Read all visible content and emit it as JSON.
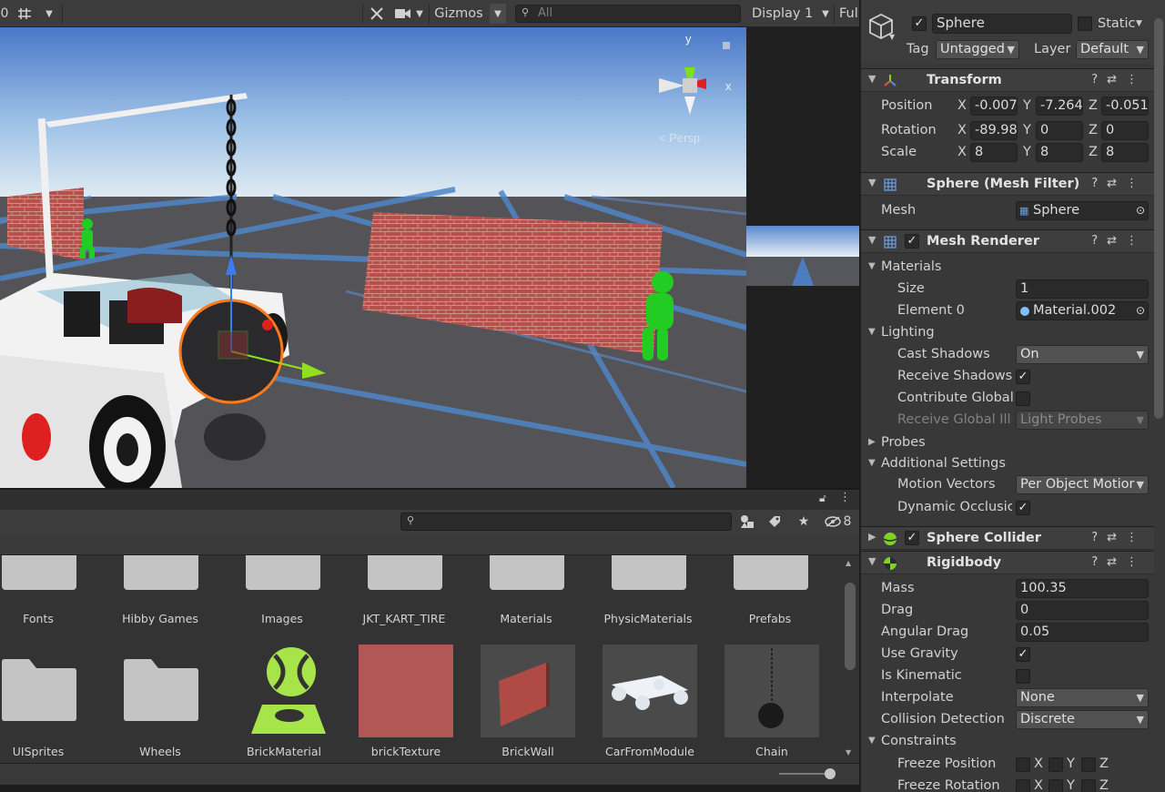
{
  "scene_toolbar": {
    "left_number": "0",
    "grid_icon": "grid-snap-icon",
    "gizmos_label": "Gizmos",
    "search_placeholder": "All"
  },
  "game_toolbar": {
    "display_label": "Display 1",
    "size_label": "Ful"
  },
  "scene": {
    "persp_label": "< Persp",
    "axis_y": "y",
    "axis_x": "x"
  },
  "project": {
    "lock_icon": "lock-icon",
    "hidden_count": "8",
    "folders_row1": [
      "Fonts",
      "Hibby Games",
      "Images",
      "JKT_KART_TIRE",
      "Materials",
      "PhysicMaterials",
      "Prefabs"
    ],
    "assets_row2": [
      "UISprites",
      "Wheels",
      "BrickMaterial",
      "brickTexture",
      "BrickWall",
      "CarFromModule",
      "Chain"
    ]
  },
  "inspector": {
    "object_name": "Sphere",
    "object_active": true,
    "static_label": "Static",
    "tag_label": "Tag",
    "tag_value": "Untagged",
    "layer_label": "Layer",
    "layer_value": "Default",
    "transform": {
      "title": "Transform",
      "position_label": "Position",
      "rotation_label": "Rotation",
      "scale_label": "Scale",
      "position": {
        "x": "-0.007",
        "y": "-7.264",
        "z": "-0.051"
      },
      "rotation": {
        "x": "-89.98",
        "y": "0",
        "z": "0"
      },
      "scale": {
        "x": "8",
        "y": "8",
        "z": "8"
      }
    },
    "mesh_filter": {
      "title": "Sphere (Mesh Filter)",
      "mesh_label": "Mesh",
      "mesh_value": "Sphere"
    },
    "mesh_renderer": {
      "title": "Mesh Renderer",
      "materials_label": "Materials",
      "size_label": "Size",
      "size_value": "1",
      "element0_label": "Element 0",
      "element0_value": "Material.002",
      "lighting_label": "Lighting",
      "cast_shadows_label": "Cast Shadows",
      "cast_shadows_value": "On",
      "receive_shadows_label": "Receive Shadows",
      "contribute_gi_label": "Contribute Global",
      "receive_gi_label": "Receive Global Illu",
      "receive_gi_value": "Light Probes",
      "probes_label": "Probes",
      "additional_label": "Additional Settings",
      "motion_vectors_label": "Motion Vectors",
      "motion_vectors_value": "Per Object Motior",
      "dynamic_occlusion_label": "Dynamic Occlusic"
    },
    "sphere_collider": {
      "title": "Sphere Collider"
    },
    "rigidbody": {
      "title": "Rigidbody",
      "mass_label": "Mass",
      "mass_value": "100.35",
      "drag_label": "Drag",
      "drag_value": "0",
      "angular_drag_label": "Angular Drag",
      "angular_drag_value": "0.05",
      "use_gravity_label": "Use Gravity",
      "is_kinematic_label": "Is Kinematic",
      "interpolate_label": "Interpolate",
      "interpolate_value": "None",
      "collision_label": "Collision Detection",
      "collision_value": "Discrete",
      "constraints_label": "Constraints",
      "freeze_position_label": "Freeze Position",
      "freeze_rotation_label": "Freeze Rotation",
      "axis_x": "X",
      "axis_y": "Y",
      "axis_z": "Z"
    }
  }
}
